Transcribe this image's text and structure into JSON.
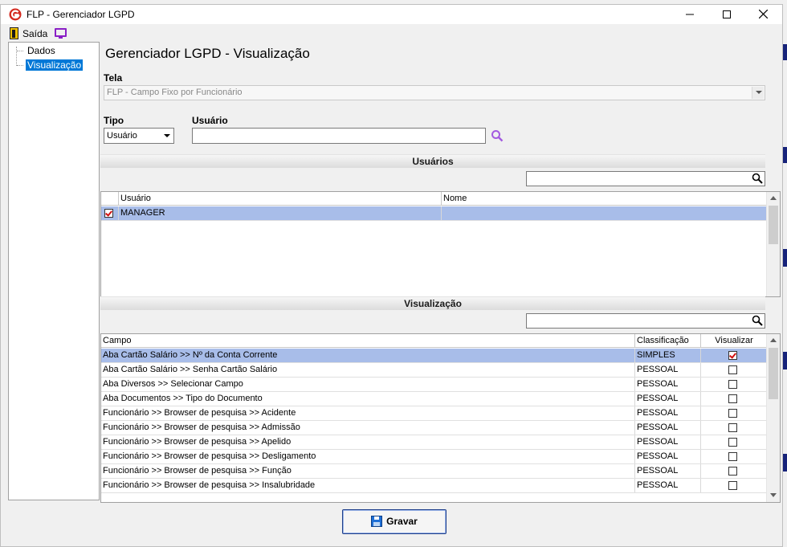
{
  "window": {
    "title": "FLP - Gerenciador LGPD",
    "minimize": "—",
    "maximize": "☐",
    "close": "✕"
  },
  "menu": {
    "exit_label": "Saída"
  },
  "tree": {
    "items": [
      {
        "label": "Dados"
      },
      {
        "label": "Visualização",
        "selected": true
      }
    ]
  },
  "page": {
    "title": "Gerenciador LGPD - Visualização"
  },
  "form": {
    "tela_label": "Tela",
    "tela_value": "FLP - Campo Fixo por Funcionário",
    "tipo_label": "Tipo",
    "tipo_value": "Usuário",
    "usuario_label": "Usuário",
    "usuario_value": ""
  },
  "usuarios_section": {
    "title": "Usuários",
    "search_value": "",
    "columns": [
      "Usuário",
      "Nome"
    ],
    "rows": [
      {
        "checked": true,
        "usuario": "MANAGER",
        "nome": ""
      }
    ]
  },
  "visualizacao_section": {
    "title": "Visualização",
    "search_value": "",
    "columns": [
      "Campo",
      "Classificação",
      "Visualizar"
    ],
    "rows": [
      {
        "campo": "Aba Cartão Salário >> Nº da Conta Corrente",
        "classificacao": "SIMPLES",
        "visualizar": true
      },
      {
        "campo": "Aba Cartão Salário >> Senha Cartão Salário",
        "classificacao": "PESSOAL",
        "visualizar": false
      },
      {
        "campo": "Aba Diversos >> Selecionar Campo",
        "classificacao": "PESSOAL",
        "visualizar": false
      },
      {
        "campo": "Aba Documentos >> Tipo do Documento",
        "classificacao": "PESSOAL",
        "visualizar": false
      },
      {
        "campo": "Funcionário >> Browser de pesquisa >> Acidente",
        "classificacao": "PESSOAL",
        "visualizar": false
      },
      {
        "campo": "Funcionário >> Browser de pesquisa >> Admissão",
        "classificacao": "PESSOAL",
        "visualizar": false
      },
      {
        "campo": "Funcionário >> Browser de pesquisa >> Apelido",
        "classificacao": "PESSOAL",
        "visualizar": false
      },
      {
        "campo": "Funcionário >> Browser de pesquisa >> Desligamento",
        "classificacao": "PESSOAL",
        "visualizar": false
      },
      {
        "campo": "Funcionário >> Browser de pesquisa >> Função",
        "classificacao": "PESSOAL",
        "visualizar": false
      },
      {
        "campo": "Funcionário >> Browser de pesquisa >> Insalubridade",
        "classificacao": "PESSOAL",
        "visualizar": false
      }
    ]
  },
  "footer": {
    "save_label": "Gravar"
  },
  "colors": {
    "selection": "#a8bde9",
    "tree_selection": "#0078d7",
    "check": "#d01010",
    "accent_purple": "#8a1fc6"
  }
}
